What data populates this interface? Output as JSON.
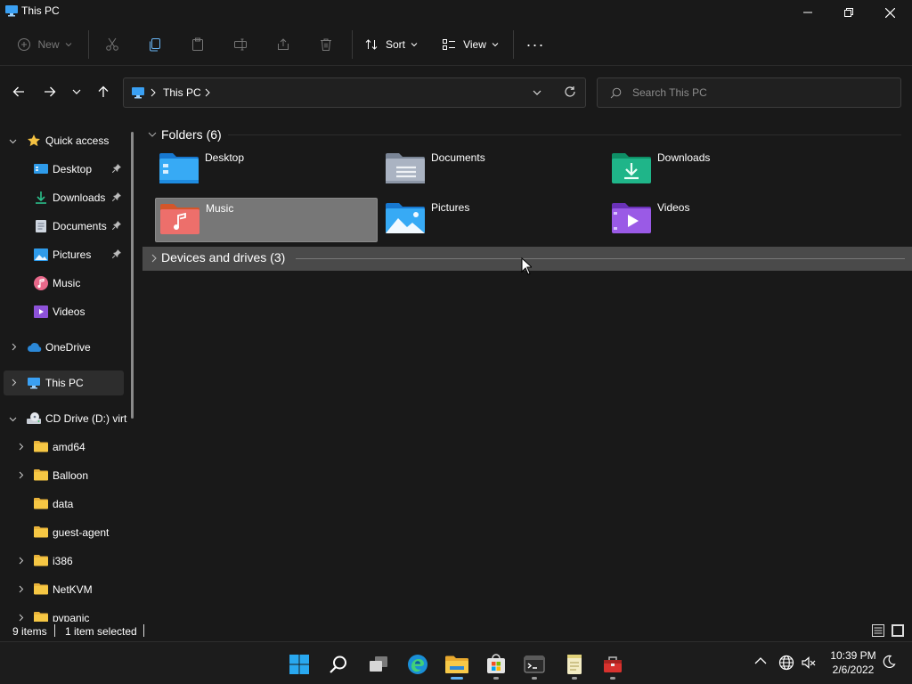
{
  "window": {
    "title": "This PC"
  },
  "toolbar": {
    "new_label": "New",
    "sort_label": "Sort",
    "view_label": "View",
    "more_label": "···"
  },
  "address": {
    "crumbs": [
      "This PC"
    ],
    "search_placeholder": "Search This PC"
  },
  "sidebar": {
    "items": [
      {
        "label": "Quick access",
        "icon": "star-icon"
      },
      {
        "label": "Desktop",
        "icon": "desktop-folder-icon",
        "pinned": true
      },
      {
        "label": "Downloads",
        "icon": "download-icon",
        "pinned": true
      },
      {
        "label": "Documents",
        "icon": "documents-icon",
        "pinned": true
      },
      {
        "label": "Pictures",
        "icon": "pictures-icon",
        "pinned": true
      },
      {
        "label": "Music",
        "icon": "music-icon"
      },
      {
        "label": "Videos",
        "icon": "videos-icon"
      },
      {
        "label": "OneDrive",
        "icon": "cloud-icon"
      },
      {
        "label": "This PC",
        "icon": "computer-icon",
        "selected": true
      },
      {
        "label": "CD Drive (D:) virt",
        "icon": "cd-drive-icon"
      },
      {
        "label": "amd64",
        "icon": "folder-icon"
      },
      {
        "label": "Balloon",
        "icon": "folder-icon"
      },
      {
        "label": "data",
        "icon": "folder-icon"
      },
      {
        "label": "guest-agent",
        "icon": "folder-icon"
      },
      {
        "label": "i386",
        "icon": "folder-icon"
      },
      {
        "label": "NetKVM",
        "icon": "folder-icon"
      },
      {
        "label": "pvpanic",
        "icon": "folder-icon"
      }
    ]
  },
  "content": {
    "folders_header": "Folders (6)",
    "devices_header": "Devices and drives (3)",
    "folders": [
      {
        "label": "Desktop",
        "icon": "desktop-folder-icon"
      },
      {
        "label": "Documents",
        "icon": "documents-folder-icon"
      },
      {
        "label": "Downloads",
        "icon": "downloads-folder-icon"
      },
      {
        "label": "Music",
        "icon": "music-folder-icon",
        "selected": true
      },
      {
        "label": "Pictures",
        "icon": "pictures-folder-icon"
      },
      {
        "label": "Videos",
        "icon": "videos-folder-icon"
      }
    ]
  },
  "status": {
    "items": "9 items",
    "selected": "1 item selected"
  },
  "taskbar": {
    "time": "10:39 PM",
    "date": "2/6/2022"
  },
  "colors": {
    "background": "#191919",
    "selected_tile": "#777777",
    "accent_blue": "#3aa0f3"
  }
}
